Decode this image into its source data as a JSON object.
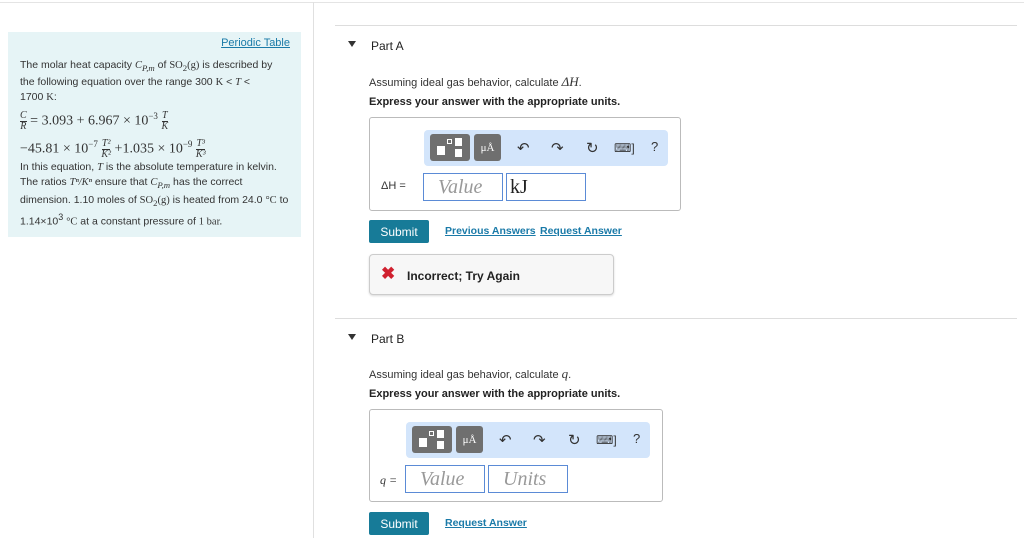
{
  "left": {
    "periodic_table": "Periodic Table",
    "p1a": "The molar heat capacity ",
    "cp": "C",
    "cp_sub": "P,m",
    "p1b": " of ",
    "so2": "SO",
    "so2_sub": "2",
    "so2_g": "(g)",
    "p1c": " is described by the following equation over the range 300 ",
    "K": "K",
    "lt": " < ",
    "T": "T",
    "p1d": "1700 ",
    "colon": ":",
    "R": "R",
    "eq1": "= 3.093 + 6.967 × 10",
    "exp_m3": "−3",
    "eq2": "−45.81 × 10",
    "exp_m7": "−7",
    "T2": "T²",
    "K2": "K²",
    "eq3": "+1.035 × 10",
    "exp_m9": "−9",
    "T3": "T³",
    "K3": "K³",
    "p2a": "In this equation, ",
    "p2b": " is the absolute temperature in kelvin. The ratios ",
    "ratio": "Tⁿ/Kⁿ",
    "p2c": " ensure that ",
    "p2d": " has the correct dimension. 1.10 moles of ",
    "p2e": " is heated from 24.0 ",
    "degC": "°C",
    "p2f": " to 1.14×10",
    "p2f_exp": "3",
    "p2g": " at a constant pressure of ",
    "bar": "1 bar."
  },
  "partA": {
    "label": "Part A",
    "q1": "Assuming ideal gas behavior, calculate ",
    "q1_var": "ΔH",
    "q1_end": ".",
    "instr": "Express your answer with the appropriate units.",
    "var_label": "ΔH =",
    "value_placeholder": "Value",
    "units_value": "kJ",
    "submit": "Submit",
    "previous_answers": "Previous Answers",
    "request_answer": "Request Answer",
    "feedback": "Incorrect; Try Again"
  },
  "partB": {
    "label": "Part B",
    "q1": "Assuming ideal gas behavior, calculate ",
    "q1_var": "q",
    "q1_end": ".",
    "instr": "Express your answer with the appropriate units.",
    "var_label": "q =",
    "value_placeholder": "Value",
    "units_placeholder": "Units",
    "submit": "Submit",
    "request_answer": "Request Answer"
  },
  "toolbar": {
    "units_btn": "μÅ",
    "help": "?"
  },
  "colors": {
    "submit": "#177b98",
    "toolbar": "#d3e5fb",
    "panel": "#e6f4f6",
    "error": "#d0202f"
  }
}
